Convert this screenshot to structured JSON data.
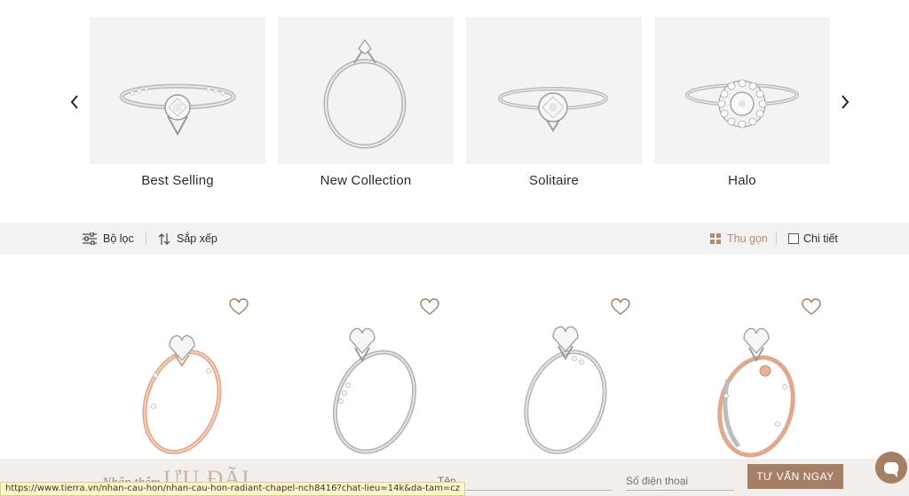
{
  "carousel": {
    "prev_icon": "chevron-left-icon",
    "next_icon": "chevron-right-icon",
    "categories": [
      {
        "label": "Best Selling",
        "image": "pave-solitaire-ring"
      },
      {
        "label": "New Collection",
        "image": "upright-solitaire-ring"
      },
      {
        "label": "Solitaire",
        "image": "classic-solitaire-ring"
      },
      {
        "label": "Halo",
        "image": "halo-ring"
      }
    ]
  },
  "toolbar": {
    "filter_label": "Bộ lọc",
    "sort_label": "Sắp xếp",
    "compact_label": "Thu gọn",
    "detail_label": "Chi tiết",
    "active_color": "#b38a6f"
  },
  "products": [
    {
      "metal": "rose-gold",
      "name": "heart-solitaire-ring"
    },
    {
      "metal": "white-gold",
      "name": "heart-solitaire-ring"
    },
    {
      "metal": "white-gold",
      "name": "heart-solitaire-ring"
    },
    {
      "metal": "two-tone",
      "name": "heart-solitaire-ring"
    }
  ],
  "cta": {
    "title_small": "Nhận thêm",
    "title_big": "ƯU ĐÃI",
    "name_placeholder": "Tên",
    "phone_placeholder": "Số điện thoại",
    "button_label": "TƯ VẤN NGAY",
    "accent_color": "#a57f64"
  },
  "status_url": "https://www.tierra.vn/nhan-cau-hon/nhan-cau-hon-radiant-chapel-nch8416?chat-lieu=14k&da-tam=cz"
}
